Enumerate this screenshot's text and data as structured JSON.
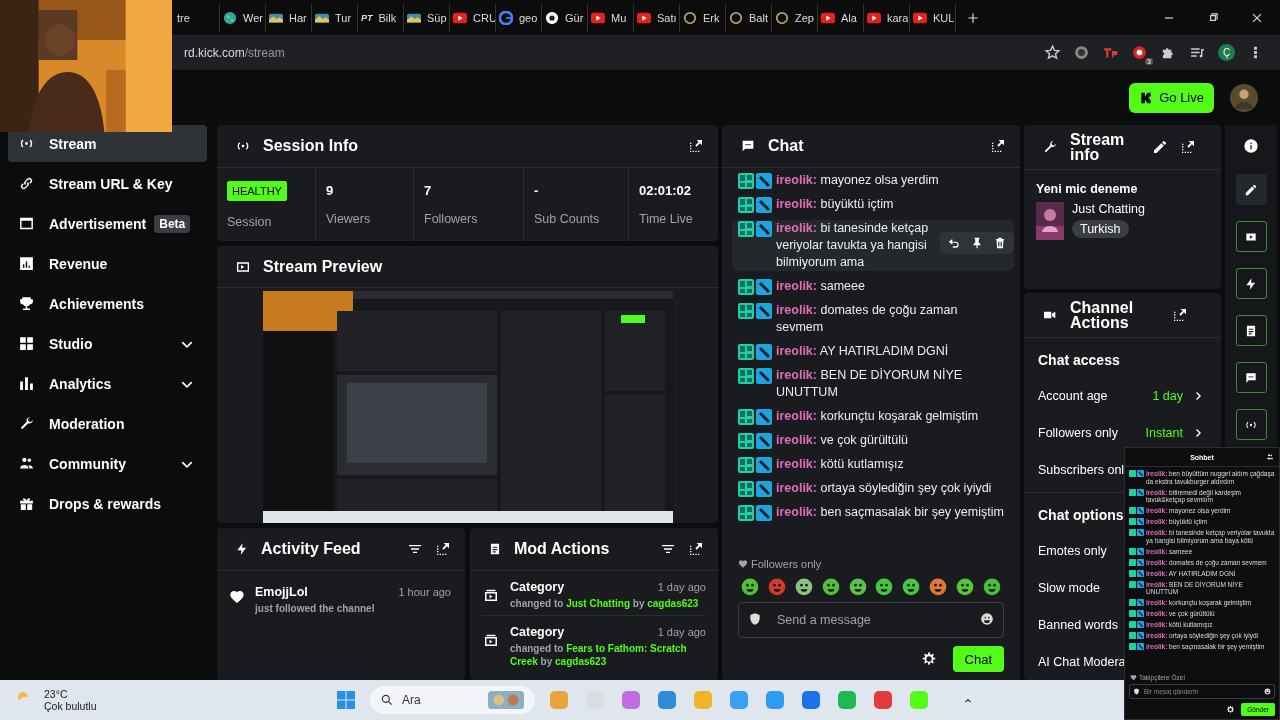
{
  "browser": {
    "tabs": [
      {
        "label": "tre"
      },
      {
        "label": "Wer"
      },
      {
        "label": "Har"
      },
      {
        "label": "Tur"
      },
      {
        "label": "Bilk",
        "icon_text": "PT"
      },
      {
        "label": "Süp"
      },
      {
        "label": "CRU"
      },
      {
        "label": "geo"
      },
      {
        "label": "Gür"
      },
      {
        "label": "Mu"
      },
      {
        "label": "Satı"
      },
      {
        "label": "Erk"
      },
      {
        "label": "Balt"
      },
      {
        "label": "Zep"
      },
      {
        "label": "Ala"
      },
      {
        "label": "kara"
      },
      {
        "label": "KUL"
      }
    ],
    "address": {
      "host": "rd.kick.com",
      "path": "/stream"
    },
    "extension_badge": "3",
    "profile_initial": "Ç"
  },
  "header": {
    "go_live": "Go Live"
  },
  "sidebar": {
    "items": [
      {
        "label": "Stream",
        "selected": true,
        "expandable": false
      },
      {
        "label": "Stream URL & Key",
        "selected": false,
        "expandable": false
      },
      {
        "label": "Advertisement",
        "badge": "Beta",
        "selected": false,
        "expandable": false
      },
      {
        "label": "Revenue",
        "selected": false,
        "expandable": false
      },
      {
        "label": "Achievements",
        "selected": false,
        "expandable": false
      },
      {
        "label": "Studio",
        "selected": false,
        "expandable": true
      },
      {
        "label": "Analytics",
        "selected": false,
        "expandable": true
      },
      {
        "label": "Moderation",
        "selected": false,
        "expandable": false
      },
      {
        "label": "Community",
        "selected": false,
        "expandable": true
      },
      {
        "label": "Drops & rewards",
        "selected": false,
        "expandable": false
      }
    ]
  },
  "session_info": {
    "title": "Session Info",
    "stats": [
      {
        "kind": "badge",
        "value": "HEALTHY",
        "label": "Session"
      },
      {
        "kind": "number",
        "value": "9",
        "label": "Viewers"
      },
      {
        "kind": "number",
        "value": "7",
        "label": "Followers"
      },
      {
        "kind": "number",
        "value": "-",
        "label": "Sub Counts"
      },
      {
        "kind": "number",
        "value": "02:01:02",
        "label": "Time Live"
      }
    ]
  },
  "stream_preview": {
    "title": "Stream Preview"
  },
  "activity_feed": {
    "title": "Activity Feed",
    "items": [
      {
        "name": "EmojjLol",
        "action": "just followed the channel",
        "time": "1 hour ago"
      }
    ]
  },
  "mod_actions": {
    "title": "Mod Actions",
    "items": [
      {
        "title": "Category",
        "time": "1 day ago",
        "prefix": "changed to",
        "category": "Just Chatting",
        "by": "by",
        "user": "cagdas623"
      },
      {
        "title": "Category",
        "time": "1 day ago",
        "prefix": "changed to",
        "category": "Fears to Fathom: Scratch Creek",
        "by": "by",
        "user": "cagdas623"
      }
    ]
  },
  "chat": {
    "title": "Chat",
    "messages": [
      {
        "user": "ireolik:",
        "text": "mayonez olsa yerdim",
        "hovered": false
      },
      {
        "user": "ireolik:",
        "text": "büyüktü içtim",
        "hovered": false
      },
      {
        "user": "ireolik:",
        "text": "bi tanesinde ketçap veriyolar tavukta ya hangisi bilmiyorum ama",
        "hovered": true
      },
      {
        "user": "ireolik:",
        "text": "sameee",
        "hovered": false
      },
      {
        "user": "ireolik:",
        "text": "domates de çoğu zaman sevmem",
        "hovered": false
      },
      {
        "user": "ireolik:",
        "text": "AY HATIRLADIM DGNİ",
        "hovered": false
      },
      {
        "user": "ireolik:",
        "text": "BEN DE DİYORUM NİYE UNUTTUM",
        "hovered": false
      },
      {
        "user": "ireolik:",
        "text": "korkunçtu koşarak gelmiştim",
        "hovered": false
      },
      {
        "user": "ireolik:",
        "text": "ve çok gürültülü",
        "hovered": false
      },
      {
        "user": "ireolik:",
        "text": "kötü kutlamışız",
        "hovered": false
      },
      {
        "user": "ireolik:",
        "text": "ortaya söylediğin şey çok iyiydi",
        "hovered": false
      },
      {
        "user": "ireolik:",
        "text": "ben saçmasalak bir şey yemiştim",
        "hovered": false
      }
    ],
    "mode": "Followers only",
    "placeholder": "Send a message",
    "send": "Chat"
  },
  "stream_info": {
    "title": "Stream info",
    "stream_title": "Yeni mic deneme",
    "category": "Just Chatting",
    "tags": [
      "Turkish"
    ]
  },
  "channel_actions": {
    "title": "Channel Actions",
    "sections": [
      {
        "heading": "Chat access",
        "rows": [
          {
            "label": "Account age",
            "value": "1 day"
          },
          {
            "label": "Followers only",
            "value": "Instant"
          },
          {
            "label": "Subscribers onl"
          }
        ]
      },
      {
        "heading": "Chat options",
        "rows": [
          {
            "label": "Emotes only"
          },
          {
            "label": "Slow mode"
          },
          {
            "label": "Banned words"
          },
          {
            "label": "AI Chat Modera"
          }
        ]
      }
    ]
  },
  "popout_chat": {
    "title": "Sohbet",
    "messages": [
      {
        "user": "ireolik:",
        "text": "ben büyüttüm nugget aldım çağdaşa da ekstra tavukburger aldırdım"
      },
      {
        "user": "ireolik:",
        "text": "bitiremedi değil kardeşim tavuk&ketçap sevmiom"
      },
      {
        "user": "ireolik:",
        "text": "mayonez olsa yerdim"
      },
      {
        "user": "ireolik:",
        "text": "büyüktü içtim"
      },
      {
        "user": "ireolik:",
        "text": "bi tanesinde ketçap veriyolar tavukta ya hangisi bilmiyorum ama baya kötü"
      },
      {
        "user": "ireolik:",
        "text": "sameee"
      },
      {
        "user": "ireolik:",
        "text": "domates de çoğu zaman sevmem"
      },
      {
        "user": "ireolik:",
        "text": "AY HATIRLADIM DGNİ"
      },
      {
        "user": "ireolik:",
        "text": "BEN DE DİYORUM NİYE UNUTTUM"
      },
      {
        "user": "ireolik:",
        "text": "korkunçtu koşarak gelmiştim"
      },
      {
        "user": "ireolik:",
        "text": "ve çok gürültülü"
      },
      {
        "user": "ireolik:",
        "text": "kötü kutlamışız"
      },
      {
        "user": "ireolik:",
        "text": "ortaya söylediğin şey çok iyiydi"
      },
      {
        "user": "ireolik:",
        "text": "ben saçmasalak bir şey yemiştim"
      }
    ],
    "mode": "Takipçilere Özel",
    "placeholder": "Bir mesaj gönderin",
    "send": "Gönder"
  },
  "taskbar": {
    "weather": {
      "temp": "23°C",
      "condition": "Çok bulutlu"
    },
    "search": "Ara"
  }
}
